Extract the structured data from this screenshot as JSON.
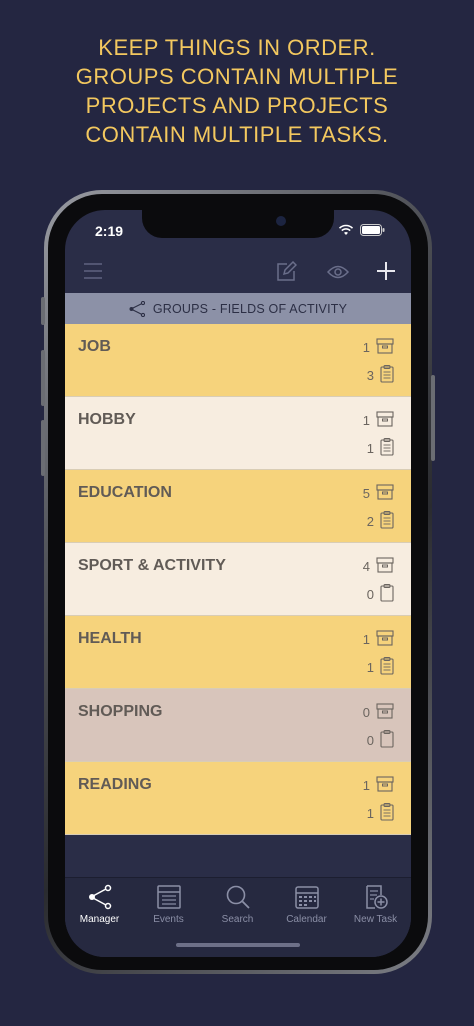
{
  "headline": {
    "line1": "KEEP THINGS IN ORDER.",
    "line2": "GROUPS CONTAIN MULTIPLE",
    "line3": "PROJECTS AND PROJECTS",
    "line4": "CONTAIN MULTIPLE TASKS."
  },
  "status_bar": {
    "time": "2:19"
  },
  "section_header": "GROUPS - FIELDS OF ACTIVITY",
  "groups": [
    {
      "name": "JOB",
      "projects": "1",
      "tasks": "3",
      "color": "#f6d37c"
    },
    {
      "name": "HOBBY",
      "projects": "1",
      "tasks": "1",
      "color": "#f7ede0"
    },
    {
      "name": "EDUCATION",
      "projects": "5",
      "tasks": "2",
      "color": "#f6d37c"
    },
    {
      "name": "SPORT & ACTIVITY",
      "projects": "4",
      "tasks": "0",
      "color": "#f7ede0"
    },
    {
      "name": "HEALTH",
      "projects": "1",
      "tasks": "1",
      "color": "#f6d37c"
    },
    {
      "name": "SHOPPING",
      "projects": "0",
      "tasks": "0",
      "color": "#d8c5bb"
    },
    {
      "name": "READING",
      "projects": "1",
      "tasks": "1",
      "color": "#f6d37c"
    }
  ],
  "tabs": [
    {
      "label": "Manager",
      "icon": "share-icon"
    },
    {
      "label": "Events",
      "icon": "events-icon"
    },
    {
      "label": "Search",
      "icon": "search-icon"
    },
    {
      "label": "Calendar",
      "icon": "calendar-icon"
    },
    {
      "label": "New Task",
      "icon": "new-task-icon"
    }
  ],
  "colors": {
    "background": "#242641",
    "headline": "#f3c85f",
    "header_bar": "#8c91a7",
    "yellow_row": "#f6d37c",
    "light_row": "#f7ede0",
    "muted_row": "#d8c5bb"
  }
}
